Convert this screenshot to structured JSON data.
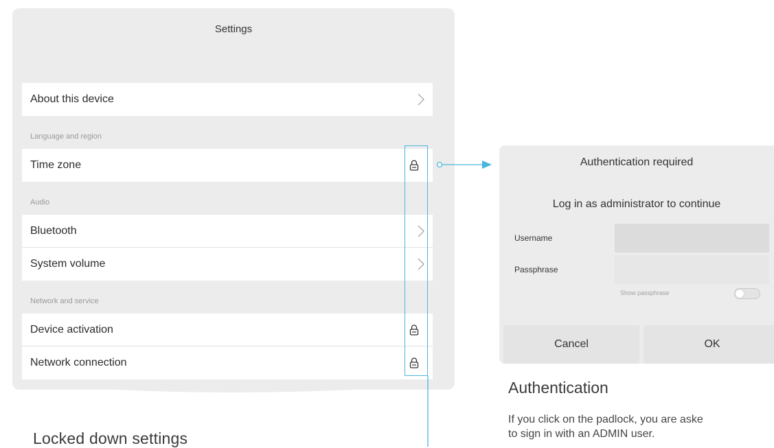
{
  "settings": {
    "title": "Settings",
    "groups": {
      "language": "Language and region",
      "audio": "Audio",
      "network": "Network and service"
    },
    "rows": {
      "about": "About this device",
      "timezone": "Time zone",
      "bluetooth": "Bluetooth",
      "volume": "System volume",
      "activation": "Device activation",
      "network_connection": "Network connection"
    }
  },
  "icons": {
    "chevron": "chevron-right-icon",
    "lock": "padlock-icon"
  },
  "colors": {
    "accent": "#4ab6dd",
    "panel_bg": "#ececec",
    "row_bg": "#ffffff"
  },
  "captions": {
    "left": "Locked down settings"
  },
  "auth": {
    "title": "Authentication required",
    "subtitle": "Log in as administrator to continue",
    "username_label": "Username",
    "passphrase_label": "Passphrase",
    "username_value": "",
    "passphrase_value": "",
    "show_passphrase": "Show passphrase",
    "show_passphrase_on": false,
    "cancel": "Cancel",
    "ok": "OK",
    "heading": "Authentication",
    "description_line1": "If you click on the padlock, you are aske",
    "description_line2": "to sign in with an ADMIN user."
  }
}
